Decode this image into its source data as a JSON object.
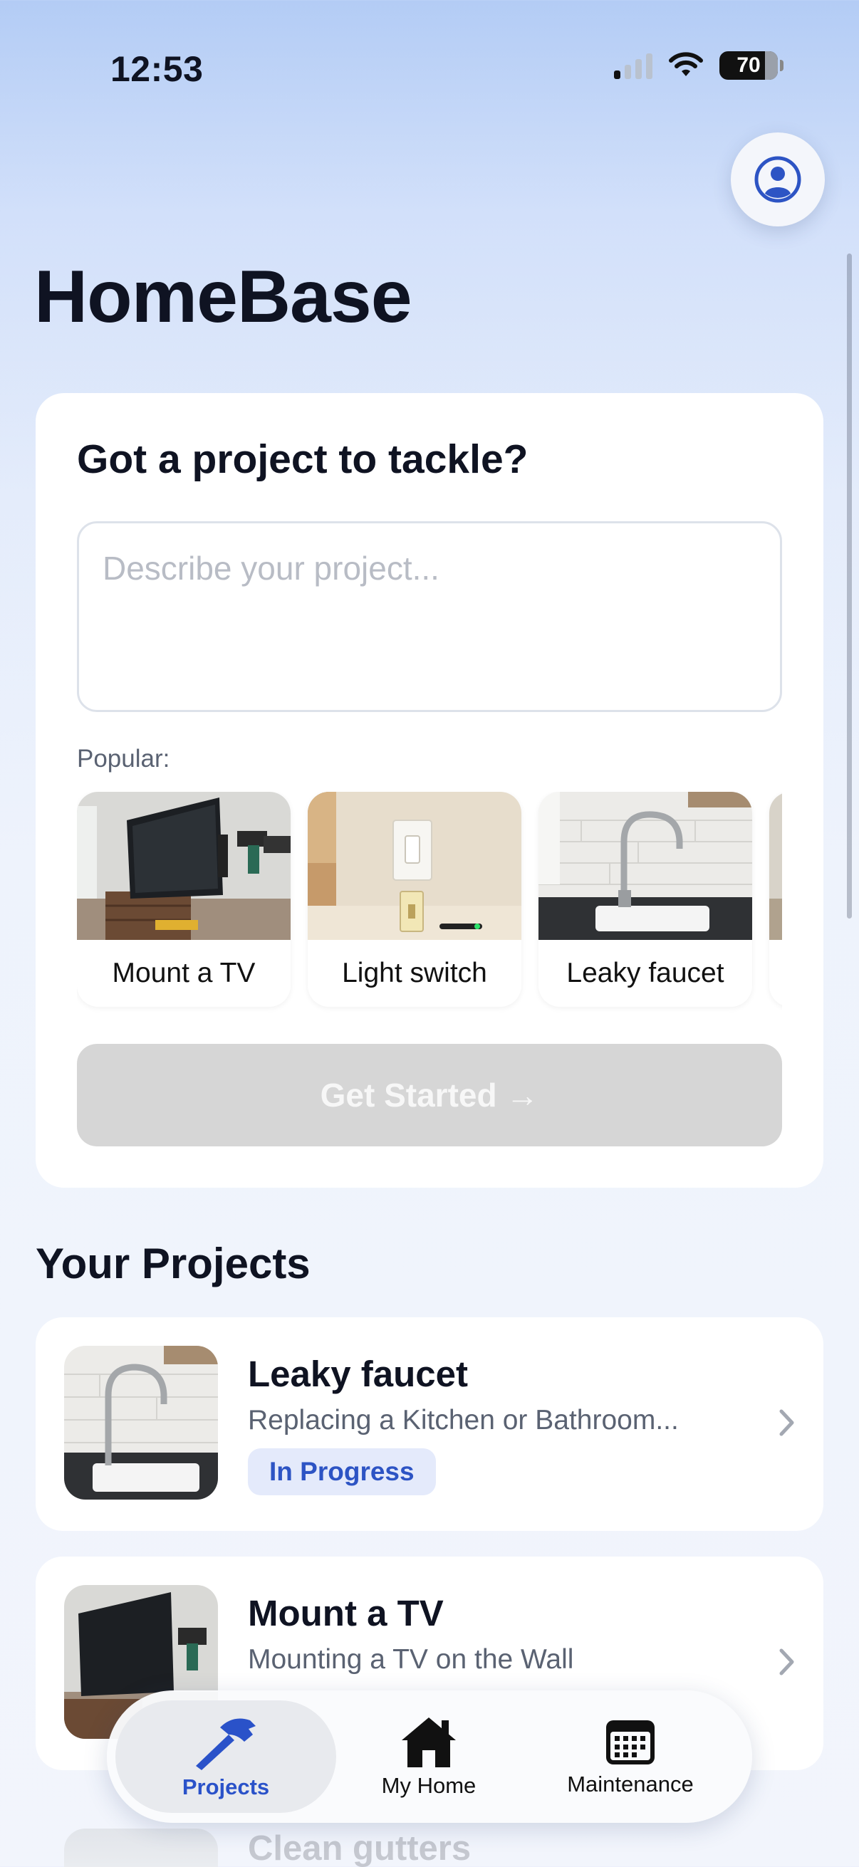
{
  "status_bar": {
    "time": "12:53",
    "battery": "70"
  },
  "app": {
    "title": "HomeBase"
  },
  "new_project": {
    "heading": "Got a project to tackle?",
    "placeholder": "Describe your project...",
    "popular_label": "Popular:",
    "popular": [
      {
        "label": "Mount a TV",
        "image": "tv-mount-photo"
      },
      {
        "label": "Light switch",
        "image": "light-switch-photo"
      },
      {
        "label": "Leaky faucet",
        "image": "kitchen-faucet-photo"
      }
    ],
    "get_started": "Get Started →"
  },
  "projects": {
    "title": "Your Projects",
    "items": [
      {
        "title": "Leaky faucet",
        "subtitle": "Replacing a Kitchen or Bathroom...",
        "status": "In Progress"
      },
      {
        "title": "Mount a TV",
        "subtitle": "Mounting a TV on the Wall"
      },
      {
        "title": "Clean gutters"
      }
    ]
  },
  "tabs": [
    {
      "label": "Projects",
      "icon": "hammer-icon",
      "active": true
    },
    {
      "label": "My Home",
      "icon": "house-icon",
      "active": false
    },
    {
      "label": "Maintenance",
      "icon": "calendar-icon",
      "active": false
    }
  ],
  "colors": {
    "accent": "#2d54c4",
    "badge_bg": "#e4eafb",
    "disabled_button": "#d6d6d6"
  }
}
